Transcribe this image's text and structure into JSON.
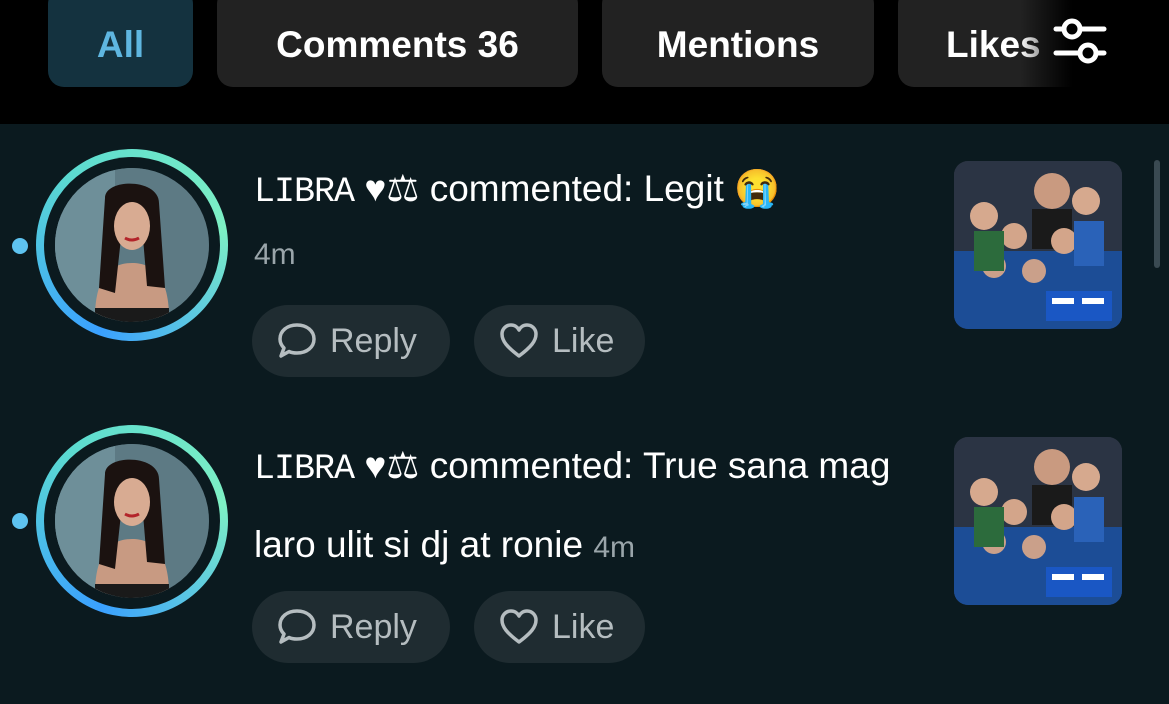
{
  "tabs": [
    {
      "label": "All",
      "active": true
    },
    {
      "label": "Comments 36",
      "active": false
    },
    {
      "label": "Mentions",
      "active": false
    },
    {
      "label": "Likes",
      "active": false
    }
  ],
  "icons": {
    "filter": "sliders-icon",
    "reply": "speech-bubble-icon",
    "like": "heart-icon",
    "emoji": "loudly-crying-face-emoji"
  },
  "colors": {
    "accent": "#5fb6e0",
    "unread_dot": "#5ec3f0",
    "background": "#0b1a1f"
  },
  "notifications": [
    {
      "username": "LIBRA",
      "badges": "♥⚖",
      "action": " commented: ",
      "comment": "Legit",
      "emoji": "😭",
      "time": "4m",
      "reply_label": "Reply",
      "like_label": "Like",
      "unread": true
    },
    {
      "username": "LIBRA",
      "badges": "♥⚖",
      "action": " commented: ",
      "comment": "True sana mag laro ulit si dj at ronie",
      "emoji": "",
      "time": "4m",
      "reply_label": "Reply",
      "like_label": "Like",
      "unread": true
    }
  ]
}
